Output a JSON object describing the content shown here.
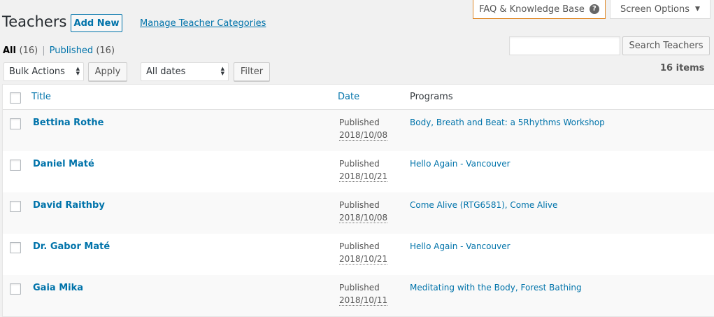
{
  "help": {
    "faq_label": "FAQ & Knowledge Base",
    "faq_icon": "?",
    "screen_options_label": "Screen Options",
    "screen_options_caret": "▼"
  },
  "header": {
    "title": "Teachers",
    "add_new_label": "Add New",
    "manage_categories_label": "Manage Teacher Categories"
  },
  "views": {
    "all_label": "All",
    "all_count": "(16)",
    "separator": "|",
    "published_label": "Published",
    "published_count": "(16)"
  },
  "search": {
    "value": "",
    "button_label": "Search Teachers"
  },
  "tablenav": {
    "bulk_actions_selected": "Bulk Actions",
    "apply_label": "Apply",
    "dates_selected": "All dates",
    "filter_label": "Filter",
    "items_count": "16 items"
  },
  "table": {
    "columns": {
      "title": "Title",
      "date": "Date",
      "programs": "Programs"
    },
    "rows": [
      {
        "name": "Bettina Rothe",
        "status": "Published",
        "date": "2018/10/08",
        "programs": "Body, Breath and Beat: a 5Rhythms Workshop"
      },
      {
        "name": "Daniel Maté",
        "status": "Published",
        "date": "2018/10/21",
        "programs": "Hello Again - Vancouver"
      },
      {
        "name": "David Raithby",
        "status": "Published",
        "date": "2018/10/08",
        "programs": "Come Alive (RTG6581), Come Alive"
      },
      {
        "name": "Dr. Gabor Maté",
        "status": "Published",
        "date": "2018/10/21",
        "programs": "Hello Again - Vancouver"
      },
      {
        "name": "Gaia Mika",
        "status": "Published",
        "date": "2018/10/11",
        "programs": "Meditating with the Body, Forest Bathing"
      }
    ]
  },
  "colors": {
    "link": "#0073aa",
    "faq_border": "#e08a2a",
    "page_bg": "#f1f1f1"
  }
}
